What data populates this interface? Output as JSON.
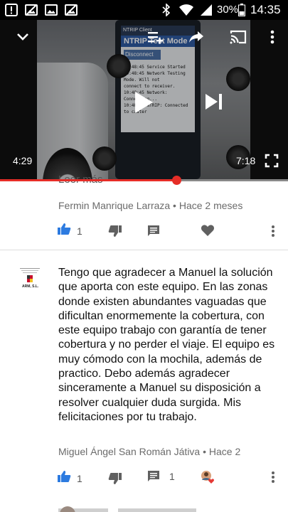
{
  "status_bar": {
    "battery_percent": "30%",
    "time": "14:35",
    "notification_icons": [
      "alert-icon",
      "image-off-icon",
      "image-icon",
      "image-off-icon"
    ],
    "system_icons": [
      "bluetooth-icon",
      "wifi-icon",
      "signal-icon",
      "battery-icon"
    ]
  },
  "player": {
    "elapsed": "4:29",
    "duration": "7:18",
    "progress": 0.613,
    "device_screen": {
      "header": "NTRIP Client",
      "title": "NTRIP Test Mode",
      "button": "Disconnect",
      "log": [
        "10:48:45 Service Started",
        "10:48:45 Network Testing Mode. Will not",
        "connect to receiver.",
        "10:48:45 Network: Connecting...",
        "10:48:49 NTRIP: Connected to caster"
      ]
    },
    "colors": {
      "progress": "#e52d27",
      "track": "#888888"
    }
  },
  "previous_comment": {
    "partial_text": "Leer más",
    "author_line": "Fermin Manrique Larraza • Hace 2 meses",
    "likes": "1"
  },
  "comment": {
    "text": "Tengo que agradecer a Manuel la solución que aporta con este equipo. En las zonas donde existen abundantes vaguadas que dificultan enormemente la cobertura, con este equipo trabajo con garantía de tener cobertura y no perder el viaje. El equipo es muy cómodo con la mochila, además de practico. Debo además agradecer sinceramente a Manuel su disposición a resolver cualquier duda surgida. Mis felicitaciones por tu trabajo.",
    "author_line": "Miguel Ángel San Román Játiva • Hace 2",
    "likes": "1",
    "replies": "1",
    "avatar_caption": "ARM, S.L."
  },
  "colors": {
    "like_blue": "#2d7be0",
    "icon_gray": "#606060"
  }
}
